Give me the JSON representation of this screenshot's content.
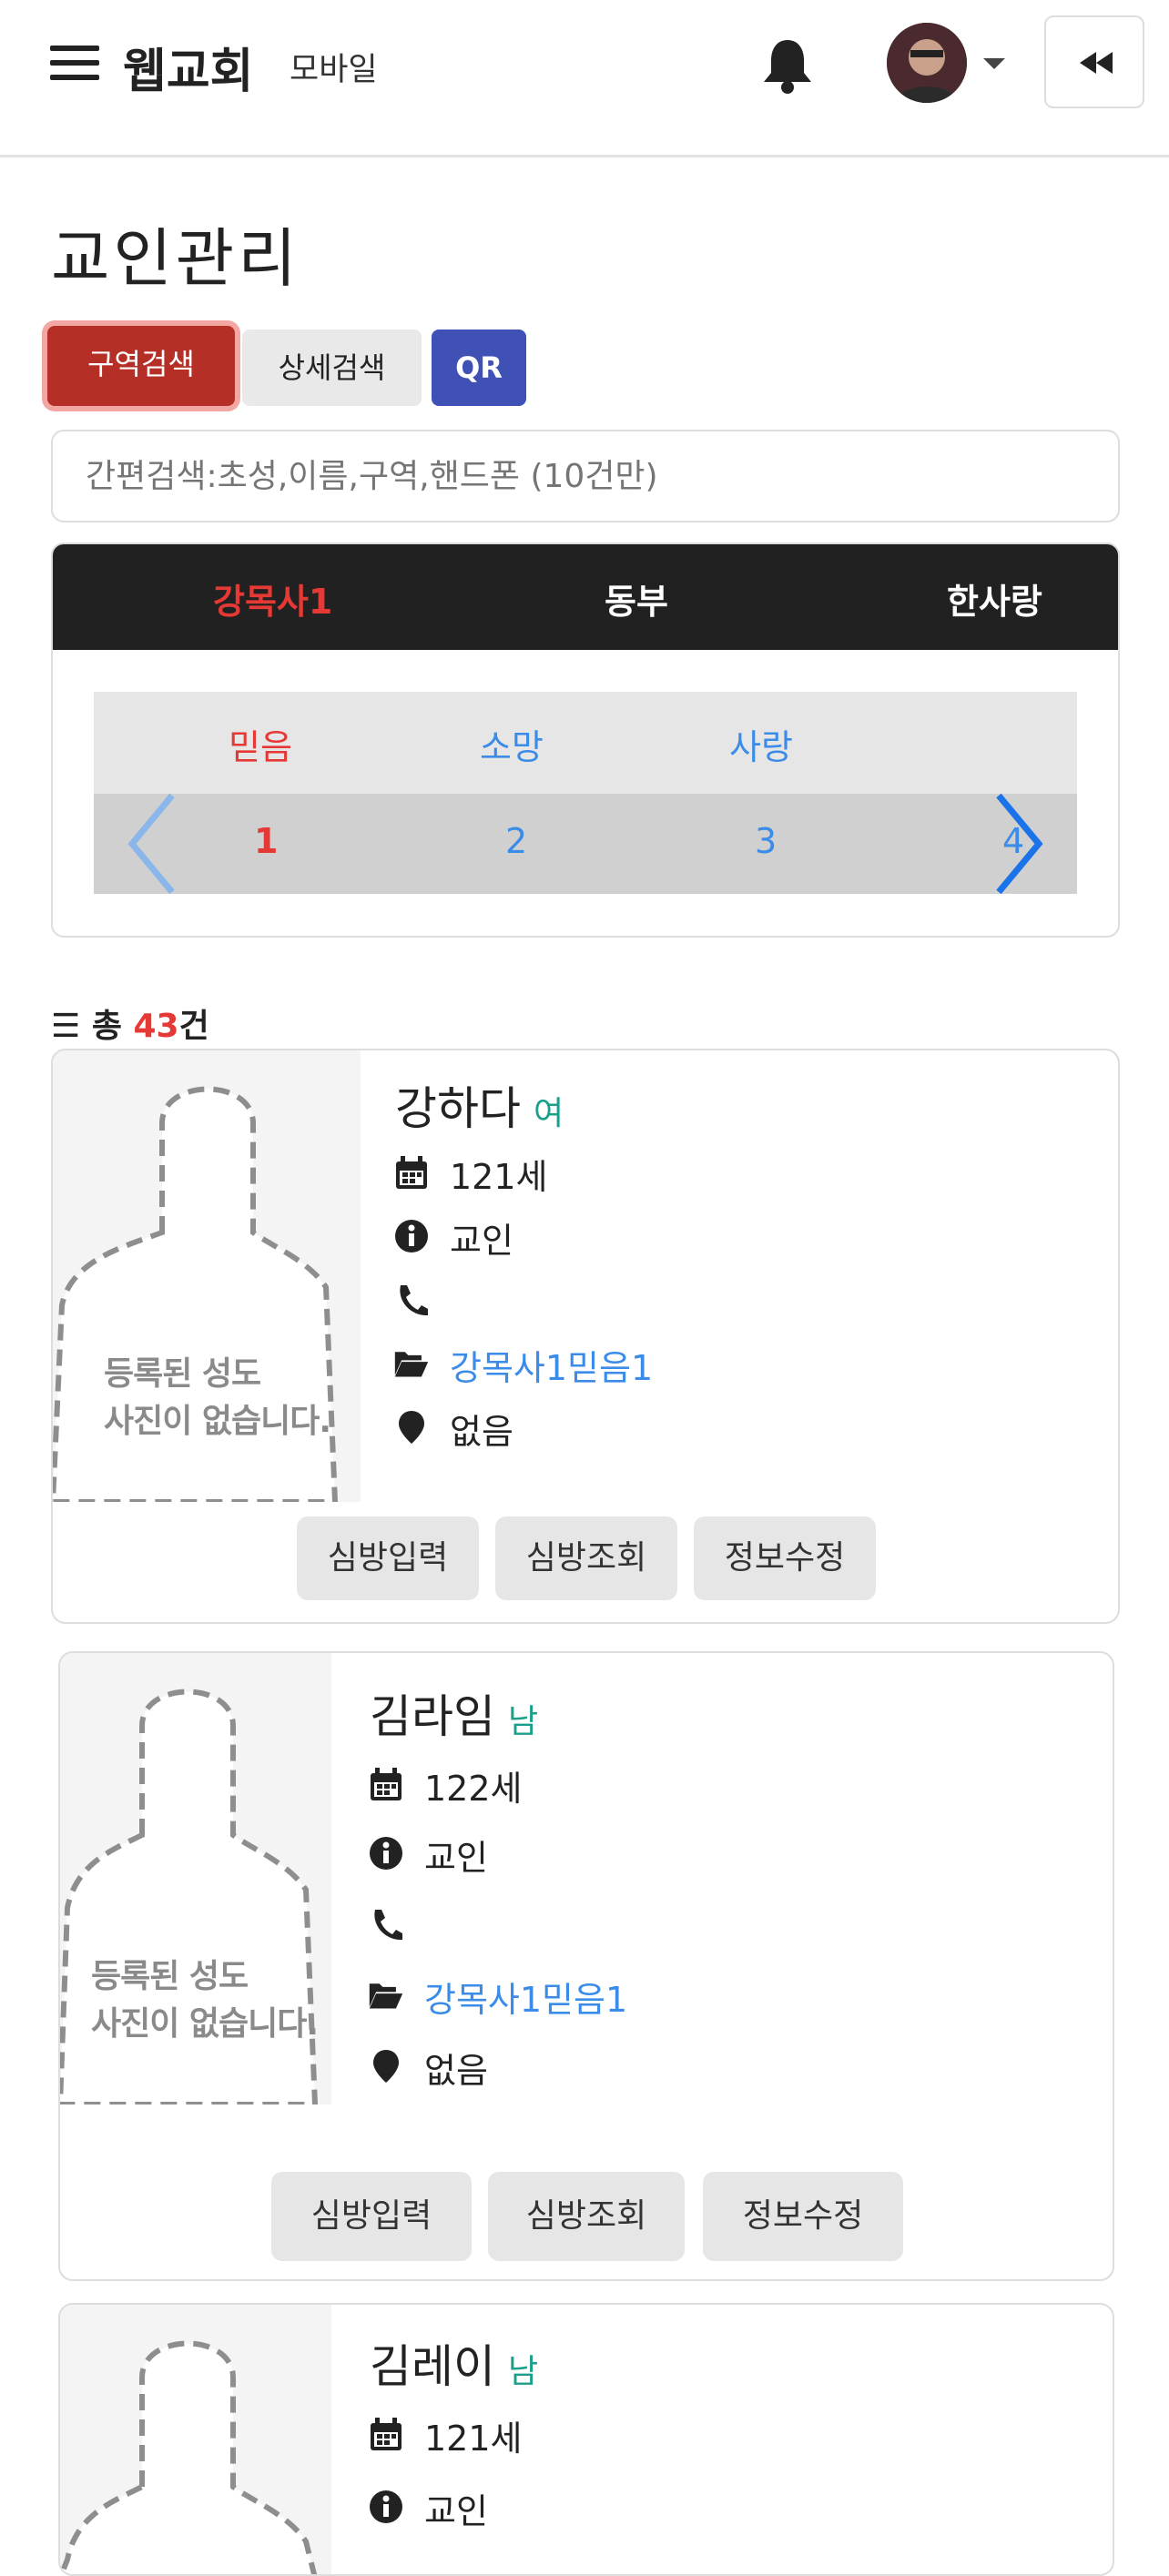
{
  "header": {
    "brand": "웹교회",
    "brand_sub": "모바일",
    "icons": [
      "menu-icon",
      "bell-icon",
      "avatar",
      "rewind-icon"
    ]
  },
  "page_title": "교인관리",
  "search": {
    "region_label": "구역검색",
    "detail_label": "상세검색",
    "qr_label": "QR",
    "quick_placeholder": "간편검색:초성,이름,구역,핸드폰 (10건만)"
  },
  "regions": {
    "tabs": [
      "강목사1",
      "동부",
      "한사랑"
    ],
    "active_tab": 0,
    "subtabs": [
      "믿음",
      "소망",
      "사랑"
    ],
    "active_subtab": 0,
    "pages": [
      "1",
      "2",
      "3",
      "4"
    ],
    "active_page": 0
  },
  "total": {
    "prefix": "총 ",
    "count": "43",
    "suffix": "건"
  },
  "no_photo_text": [
    "등록된 성도",
    "사진이 없습니다."
  ],
  "members": [
    {
      "name": "강하다",
      "gender": "여",
      "age": "121세",
      "type": "교인",
      "phone": "",
      "group": "강목사1믿음1",
      "address": "없음"
    },
    {
      "name": "김라임",
      "gender": "남",
      "age": "122세",
      "type": "교인",
      "phone": "",
      "group": "강목사1믿음1",
      "address": "없음"
    },
    {
      "name": "김레이",
      "gender": "남",
      "age": "121세",
      "type": "교인"
    }
  ],
  "card_buttons": [
    "심방입력",
    "심방조회",
    "정보수정"
  ],
  "colors": {
    "active_red": "#e53935",
    "link_blue": "#3b8be8",
    "region_btn": "#b52f27",
    "qr_btn": "#3f51b5",
    "gender": "#1aa08a"
  }
}
